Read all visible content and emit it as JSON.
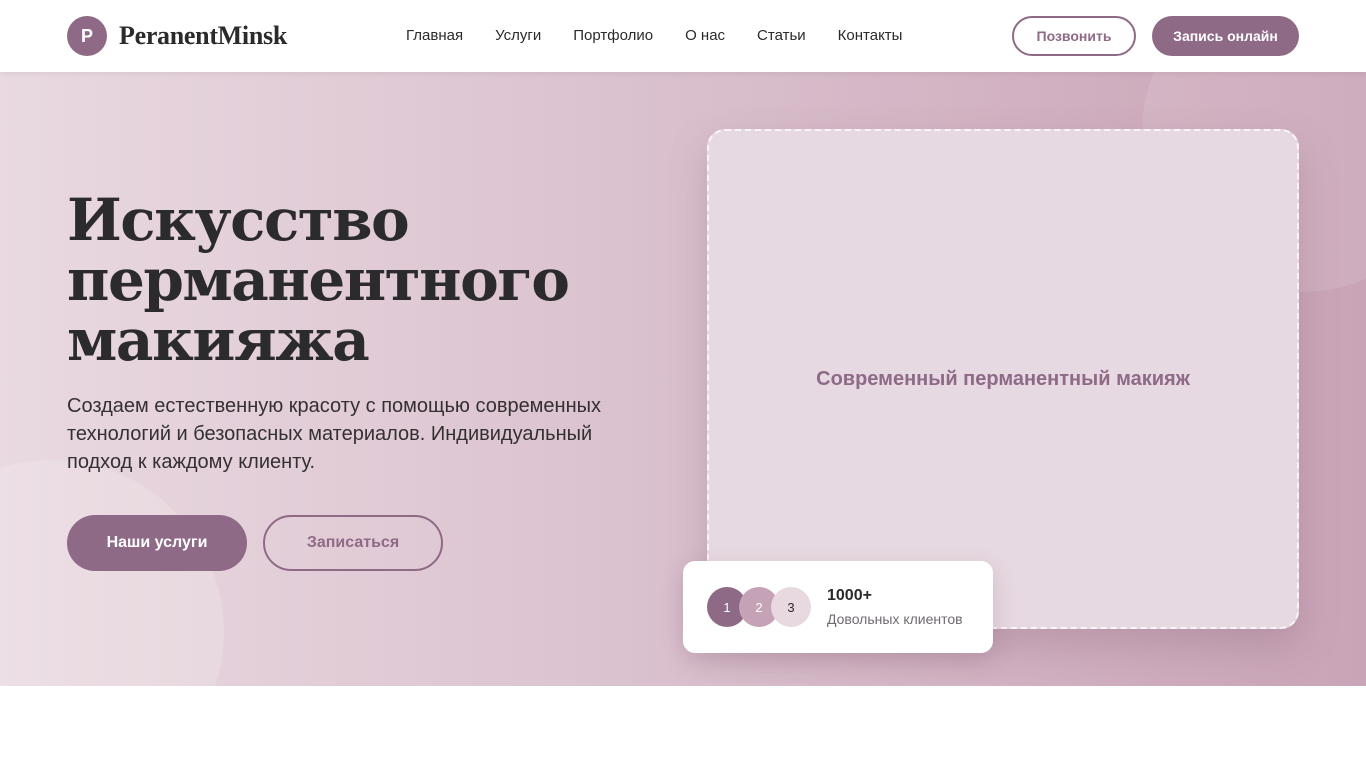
{
  "brand": {
    "logo_letter": "P",
    "name": "PeranentMinsk",
    "accent_color": "#8e6a86"
  },
  "nav": {
    "items": [
      {
        "label": "Главная"
      },
      {
        "label": "Услуги"
      },
      {
        "label": "Портфолио"
      },
      {
        "label": "О нас"
      },
      {
        "label": "Статьи"
      },
      {
        "label": "Контакты"
      }
    ]
  },
  "header_actions": {
    "call_label": "Позвонить",
    "book_label": "Запись онлайн"
  },
  "hero": {
    "title_lines": [
      "Искусство",
      "перманентного",
      "макияжа"
    ],
    "description": "Создаем естественную красоту с помощью современных технологий и безопасных материалов. Индивидуальный подход к каждому клиенту.",
    "services_button": "Наши услуги",
    "signup_button": "Записаться",
    "image_label": "Современный перманентный макияж"
  },
  "stats": {
    "avatars": [
      "1",
      "2",
      "3"
    ],
    "number": "1000+",
    "label": "Довольных клиентов"
  }
}
